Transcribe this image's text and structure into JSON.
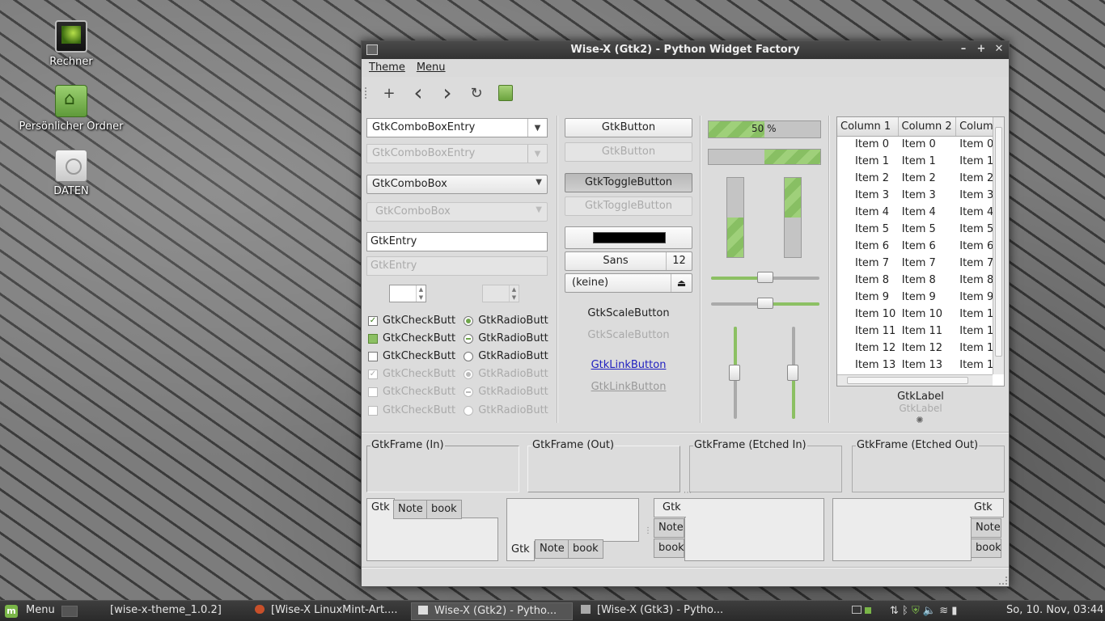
{
  "desktop": {
    "icons": [
      {
        "label": "Rechner",
        "icon": "computer-icon"
      },
      {
        "label": "Persönlicher Ordner",
        "icon": "home-folder-icon"
      },
      {
        "label": "DATEN",
        "icon": "drive-icon"
      }
    ]
  },
  "window": {
    "title": "Wise-X (Gtk2) - Python Widget Factory",
    "controls": {
      "minimize": "–",
      "maximize": "+",
      "close": "✕"
    },
    "menu": [
      "Theme",
      "Menu"
    ],
    "toolbar": {
      "add": "+",
      "back": "‹",
      "forward": "›",
      "refresh": "↻",
      "paste": "clipboard"
    },
    "col1": {
      "combo_entry": "GtkComboBoxEntry",
      "combo_entry_disabled": "GtkComboBoxEntry",
      "combo": "GtkComboBox",
      "combo_disabled": "GtkComboBox",
      "entry": "GtkEntry",
      "entry_disabled_placeholder": "GtkEntry",
      "check_label": "GtkCheckButt",
      "radio_label": "GtkRadioButt"
    },
    "col2": {
      "button": "GtkButton",
      "button_disabled": "GtkButton",
      "toggle": "GtkToggleButton",
      "toggle_disabled": "GtkToggleButton",
      "color_value": "#000000",
      "font_name": "Sans",
      "font_size": "12",
      "file_chooser": "(keine)",
      "scale_button": "GtkScaleButton",
      "scale_button_disabled": "GtkScaleButton",
      "link": "GtkLinkButton",
      "link_disabled": "GtkLinkButton"
    },
    "col3": {
      "progress_text": "50 %",
      "progress_value": 0.5,
      "progress2_value": 0.5,
      "vbar1_value": 0.5,
      "vbar2_value": 0.5,
      "hscale1_value": 0.5,
      "hscale2_value": 0.5,
      "vscale1_value": 0.5,
      "vscale2_value": 0.5
    },
    "tree": {
      "columns": [
        "Column 1",
        "Column 2",
        "Colum"
      ],
      "rows": [
        [
          "Item 0",
          "Item 0",
          "Item 0"
        ],
        [
          "Item 1",
          "Item 1",
          "Item 1"
        ],
        [
          "Item 2",
          "Item 2",
          "Item 2"
        ],
        [
          "Item 3",
          "Item 3",
          "Item 3"
        ],
        [
          "Item 4",
          "Item 4",
          "Item 4"
        ],
        [
          "Item 5",
          "Item 5",
          "Item 5"
        ],
        [
          "Item 6",
          "Item 6",
          "Item 6"
        ],
        [
          "Item 7",
          "Item 7",
          "Item 7"
        ],
        [
          "Item 8",
          "Item 8",
          "Item 8"
        ],
        [
          "Item 9",
          "Item 9",
          "Item 9"
        ],
        [
          "Item 10",
          "Item 10",
          "Item 1"
        ],
        [
          "Item 11",
          "Item 11",
          "Item 1"
        ],
        [
          "Item 12",
          "Item 12",
          "Item 1"
        ],
        [
          "Item 13",
          "Item 13",
          "Item 1"
        ]
      ],
      "label": "GtkLabel",
      "label_disabled": "GtkLabel"
    },
    "frames": [
      "GtkFrame (In)",
      "GtkFrame (Out)",
      "GtkFrame (Etched In)",
      "GtkFrame (Etched Out)"
    ],
    "notebook_tabs": [
      "Gtk",
      "Note",
      "book"
    ]
  },
  "panel": {
    "menu_label": "Menu",
    "tasks": [
      {
        "label": "[wise-x-theme_1.0.2]",
        "active": false
      },
      {
        "label": "[Wise-X LinuxMint-Art....",
        "active": false
      },
      {
        "label": "Wise-X (Gtk2) - Pytho...",
        "active": true
      },
      {
        "label": "[Wise-X (Gtk3) - Pytho...",
        "active": false
      }
    ],
    "clock": "So, 10. Nov, 03:44"
  }
}
